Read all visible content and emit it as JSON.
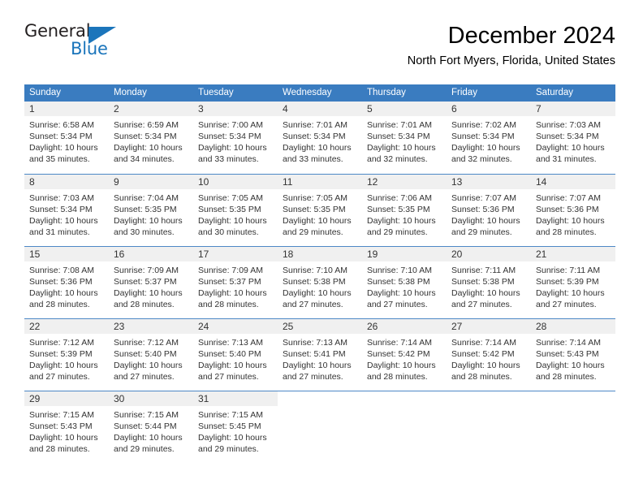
{
  "brand": {
    "name_top": "General",
    "name_bottom": "Blue",
    "color_primary": "#1b75bb",
    "color_text": "#231f20"
  },
  "header": {
    "month_title": "December 2024",
    "location": "North Fort Myers, Florida, United States"
  },
  "theme": {
    "header_blue": "#3a7cc0",
    "day_band_gray": "#f0f0f0",
    "text_color": "#333333"
  },
  "weekdays": [
    "Sunday",
    "Monday",
    "Tuesday",
    "Wednesday",
    "Thursday",
    "Friday",
    "Saturday"
  ],
  "weeks": [
    [
      {
        "day": "1",
        "sunrise": "Sunrise: 6:58 AM",
        "sunset": "Sunset: 5:34 PM",
        "daylight_1": "Daylight: 10 hours",
        "daylight_2": "and 35 minutes."
      },
      {
        "day": "2",
        "sunrise": "Sunrise: 6:59 AM",
        "sunset": "Sunset: 5:34 PM",
        "daylight_1": "Daylight: 10 hours",
        "daylight_2": "and 34 minutes."
      },
      {
        "day": "3",
        "sunrise": "Sunrise: 7:00 AM",
        "sunset": "Sunset: 5:34 PM",
        "daylight_1": "Daylight: 10 hours",
        "daylight_2": "and 33 minutes."
      },
      {
        "day": "4",
        "sunrise": "Sunrise: 7:01 AM",
        "sunset": "Sunset: 5:34 PM",
        "daylight_1": "Daylight: 10 hours",
        "daylight_2": "and 33 minutes."
      },
      {
        "day": "5",
        "sunrise": "Sunrise: 7:01 AM",
        "sunset": "Sunset: 5:34 PM",
        "daylight_1": "Daylight: 10 hours",
        "daylight_2": "and 32 minutes."
      },
      {
        "day": "6",
        "sunrise": "Sunrise: 7:02 AM",
        "sunset": "Sunset: 5:34 PM",
        "daylight_1": "Daylight: 10 hours",
        "daylight_2": "and 32 minutes."
      },
      {
        "day": "7",
        "sunrise": "Sunrise: 7:03 AM",
        "sunset": "Sunset: 5:34 PM",
        "daylight_1": "Daylight: 10 hours",
        "daylight_2": "and 31 minutes."
      }
    ],
    [
      {
        "day": "8",
        "sunrise": "Sunrise: 7:03 AM",
        "sunset": "Sunset: 5:34 PM",
        "daylight_1": "Daylight: 10 hours",
        "daylight_2": "and 31 minutes."
      },
      {
        "day": "9",
        "sunrise": "Sunrise: 7:04 AM",
        "sunset": "Sunset: 5:35 PM",
        "daylight_1": "Daylight: 10 hours",
        "daylight_2": "and 30 minutes."
      },
      {
        "day": "10",
        "sunrise": "Sunrise: 7:05 AM",
        "sunset": "Sunset: 5:35 PM",
        "daylight_1": "Daylight: 10 hours",
        "daylight_2": "and 30 minutes."
      },
      {
        "day": "11",
        "sunrise": "Sunrise: 7:05 AM",
        "sunset": "Sunset: 5:35 PM",
        "daylight_1": "Daylight: 10 hours",
        "daylight_2": "and 29 minutes."
      },
      {
        "day": "12",
        "sunrise": "Sunrise: 7:06 AM",
        "sunset": "Sunset: 5:35 PM",
        "daylight_1": "Daylight: 10 hours",
        "daylight_2": "and 29 minutes."
      },
      {
        "day": "13",
        "sunrise": "Sunrise: 7:07 AM",
        "sunset": "Sunset: 5:36 PM",
        "daylight_1": "Daylight: 10 hours",
        "daylight_2": "and 29 minutes."
      },
      {
        "day": "14",
        "sunrise": "Sunrise: 7:07 AM",
        "sunset": "Sunset: 5:36 PM",
        "daylight_1": "Daylight: 10 hours",
        "daylight_2": "and 28 minutes."
      }
    ],
    [
      {
        "day": "15",
        "sunrise": "Sunrise: 7:08 AM",
        "sunset": "Sunset: 5:36 PM",
        "daylight_1": "Daylight: 10 hours",
        "daylight_2": "and 28 minutes."
      },
      {
        "day": "16",
        "sunrise": "Sunrise: 7:09 AM",
        "sunset": "Sunset: 5:37 PM",
        "daylight_1": "Daylight: 10 hours",
        "daylight_2": "and 28 minutes."
      },
      {
        "day": "17",
        "sunrise": "Sunrise: 7:09 AM",
        "sunset": "Sunset: 5:37 PM",
        "daylight_1": "Daylight: 10 hours",
        "daylight_2": "and 28 minutes."
      },
      {
        "day": "18",
        "sunrise": "Sunrise: 7:10 AM",
        "sunset": "Sunset: 5:38 PM",
        "daylight_1": "Daylight: 10 hours",
        "daylight_2": "and 27 minutes."
      },
      {
        "day": "19",
        "sunrise": "Sunrise: 7:10 AM",
        "sunset": "Sunset: 5:38 PM",
        "daylight_1": "Daylight: 10 hours",
        "daylight_2": "and 27 minutes."
      },
      {
        "day": "20",
        "sunrise": "Sunrise: 7:11 AM",
        "sunset": "Sunset: 5:38 PM",
        "daylight_1": "Daylight: 10 hours",
        "daylight_2": "and 27 minutes."
      },
      {
        "day": "21",
        "sunrise": "Sunrise: 7:11 AM",
        "sunset": "Sunset: 5:39 PM",
        "daylight_1": "Daylight: 10 hours",
        "daylight_2": "and 27 minutes."
      }
    ],
    [
      {
        "day": "22",
        "sunrise": "Sunrise: 7:12 AM",
        "sunset": "Sunset: 5:39 PM",
        "daylight_1": "Daylight: 10 hours",
        "daylight_2": "and 27 minutes."
      },
      {
        "day": "23",
        "sunrise": "Sunrise: 7:12 AM",
        "sunset": "Sunset: 5:40 PM",
        "daylight_1": "Daylight: 10 hours",
        "daylight_2": "and 27 minutes."
      },
      {
        "day": "24",
        "sunrise": "Sunrise: 7:13 AM",
        "sunset": "Sunset: 5:40 PM",
        "daylight_1": "Daylight: 10 hours",
        "daylight_2": "and 27 minutes."
      },
      {
        "day": "25",
        "sunrise": "Sunrise: 7:13 AM",
        "sunset": "Sunset: 5:41 PM",
        "daylight_1": "Daylight: 10 hours",
        "daylight_2": "and 27 minutes."
      },
      {
        "day": "26",
        "sunrise": "Sunrise: 7:14 AM",
        "sunset": "Sunset: 5:42 PM",
        "daylight_1": "Daylight: 10 hours",
        "daylight_2": "and 28 minutes."
      },
      {
        "day": "27",
        "sunrise": "Sunrise: 7:14 AM",
        "sunset": "Sunset: 5:42 PM",
        "daylight_1": "Daylight: 10 hours",
        "daylight_2": "and 28 minutes."
      },
      {
        "day": "28",
        "sunrise": "Sunrise: 7:14 AM",
        "sunset": "Sunset: 5:43 PM",
        "daylight_1": "Daylight: 10 hours",
        "daylight_2": "and 28 minutes."
      }
    ],
    [
      {
        "day": "29",
        "sunrise": "Sunrise: 7:15 AM",
        "sunset": "Sunset: 5:43 PM",
        "daylight_1": "Daylight: 10 hours",
        "daylight_2": "and 28 minutes."
      },
      {
        "day": "30",
        "sunrise": "Sunrise: 7:15 AM",
        "sunset": "Sunset: 5:44 PM",
        "daylight_1": "Daylight: 10 hours",
        "daylight_2": "and 29 minutes."
      },
      {
        "day": "31",
        "sunrise": "Sunrise: 7:15 AM",
        "sunset": "Sunset: 5:45 PM",
        "daylight_1": "Daylight: 10 hours",
        "daylight_2": "and 29 minutes."
      },
      {
        "day": "",
        "sunrise": "",
        "sunset": "",
        "daylight_1": "",
        "daylight_2": ""
      },
      {
        "day": "",
        "sunrise": "",
        "sunset": "",
        "daylight_1": "",
        "daylight_2": ""
      },
      {
        "day": "",
        "sunrise": "",
        "sunset": "",
        "daylight_1": "",
        "daylight_2": ""
      },
      {
        "day": "",
        "sunrise": "",
        "sunset": "",
        "daylight_1": "",
        "daylight_2": ""
      }
    ]
  ]
}
